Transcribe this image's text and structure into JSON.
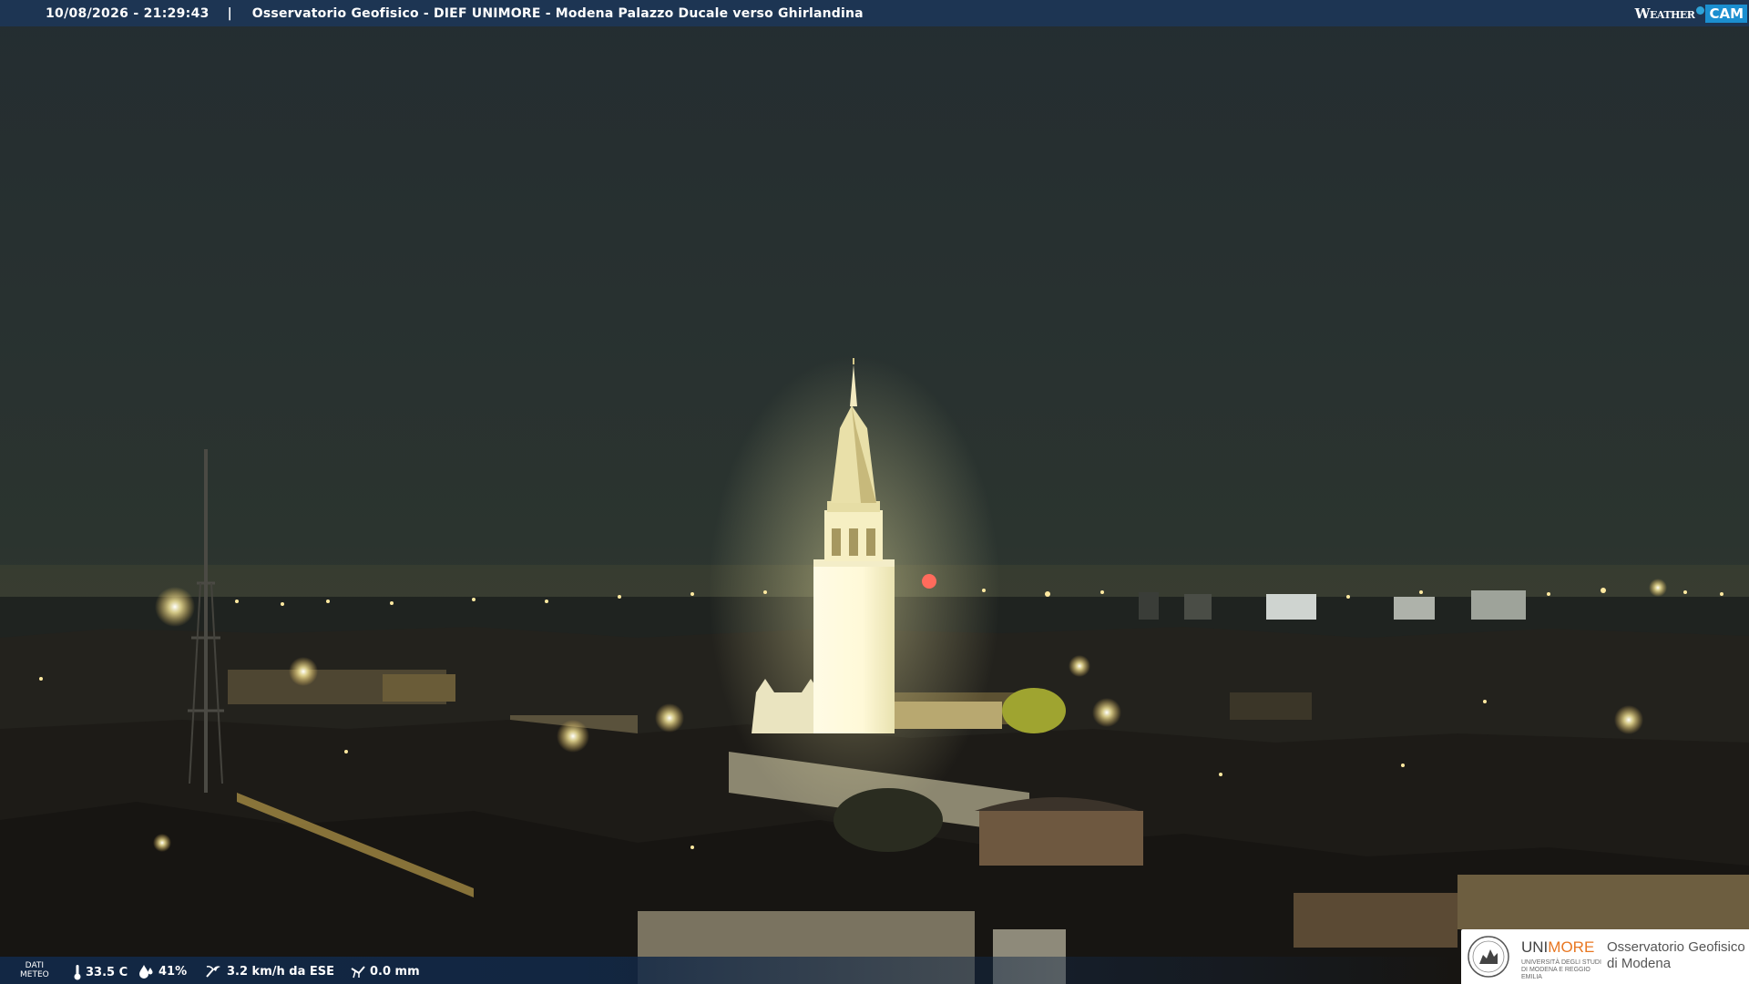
{
  "header": {
    "datetime": "10/08/2026 - 21:29:43",
    "separator": "|",
    "caption": "Osservatorio Geofisico - DIEF UNIMORE - Modena Palazzo Ducale verso Ghirlandina",
    "brand_weather": "Weather",
    "brand_cam": "CAM"
  },
  "weather": {
    "label_line1": "DATI",
    "label_line2": "METEO",
    "temperature": "33.5 C",
    "humidity": "41%",
    "wind": "3.2 km/h da ESE",
    "rain": "0.0 mm",
    "icons": [
      "thermometer-icon",
      "humidity-drop-icon",
      "wind-icon",
      "rain-gauge-icon"
    ]
  },
  "logo": {
    "uni": "UNI",
    "more": "MORE",
    "uni_sub": "UNIVERSITÀ DEGLI STUDI DI MODENA E REGGIO EMILIA",
    "osservatorio_line1": "Osservatorio Geofisico",
    "osservatorio_line2": "di Modena"
  },
  "colors": {
    "header_bg": "#1d3553",
    "sky": "#27312f",
    "tower_light": "#fffbe0",
    "city_lights": "#ffd86a",
    "unimore_orange": "#e87722",
    "weathercam_blue": "#1b8fd0"
  }
}
